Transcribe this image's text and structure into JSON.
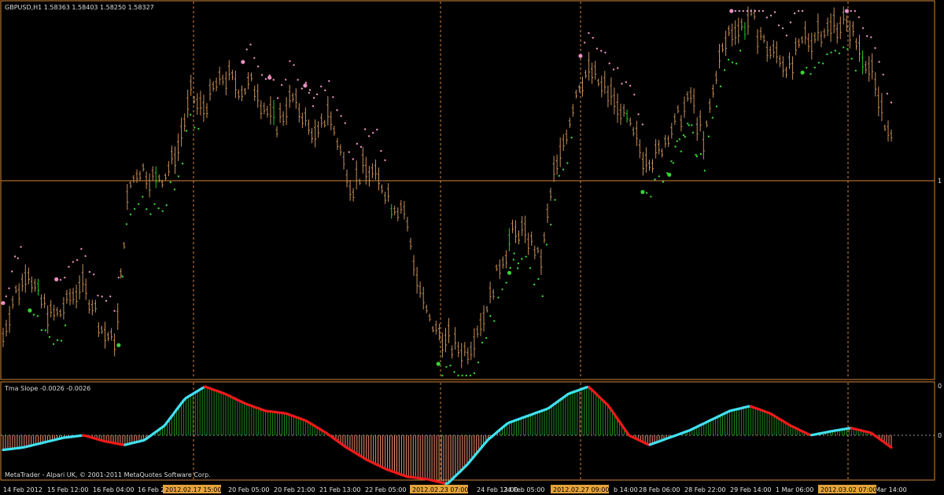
{
  "colors": {
    "background": "#000000",
    "frame": "#d2863a",
    "bar": "#c6905a",
    "bar_bull_accent": "#22cc22",
    "upper_band_dots": "#e890c0",
    "lower_band_dots": "#36d236",
    "separator_line": "#d2863a",
    "price_line": "#d2863a",
    "slope_positive_hist": "#1f8c1f",
    "slope_negative_hist": "#f09070",
    "slope_rising_line": "#40e0f0",
    "slope_falling_line": "#ee1a1a",
    "zero_line": "#c8c8c8",
    "date_highlight": "#e5a33a"
  },
  "main_panel": {
    "title": "GBPUSD,H1  1.58363 1.58403 1.58250 1.58327",
    "icon": "chart-window-icon"
  },
  "indicator_panel": {
    "title": "Tma Slope -0.0026 -0.0026",
    "axis_labels": [
      "0",
      "0"
    ]
  },
  "copyright": "MetaTrader - Alpari UK, © 2001-2011 MetaQuotes Software Corp.",
  "time_axis": {
    "labels": [
      "14 Feb 2012",
      "15 Feb 12:00",
      "16 Feb 04:00",
      "16 Feb 2",
      "20 Feb 05:00",
      "20 Feb 21:00",
      "21 Feb 13:00",
      "22 Feb 05:00",
      "24 Feb 13:00",
      "24 Feb 05:00",
      "b 14:00",
      "28 Feb 06:00",
      "28 Feb 22:00",
      "29 Feb 14:00",
      "1 Mar 06:00",
      "Mar 14:00"
    ],
    "highlighted": [
      "2012.02.17 15:00",
      "2012.02.23 07:00",
      "2012.02.27 09:00",
      "2012.03.02 07:00"
    ]
  },
  "price_axis": {
    "label": "1"
  },
  "chart_data": {
    "type": "candlestick",
    "symbol": "GBPUSD",
    "timeframe": "H1",
    "last_quote": {
      "open": 1.58363,
      "high": 1.58403,
      "low": 1.5825,
      "close": 1.58327
    },
    "period_separators": [
      "2012.02.17 15:00",
      "2012.02.23 07:00",
      "2012.02.27 09:00",
      "2012.03.02 07:00"
    ],
    "price_series_relative": [
      0.1,
      0.22,
      0.28,
      0.2,
      0.15,
      0.18,
      0.24,
      0.2,
      0.1,
      0.08,
      0.52,
      0.58,
      0.54,
      0.56,
      0.63,
      0.78,
      0.74,
      0.82,
      0.84,
      0.8,
      0.82,
      0.74,
      0.7,
      0.78,
      0.72,
      0.66,
      0.74,
      0.62,
      0.52,
      0.58,
      0.55,
      0.48,
      0.46,
      0.28,
      0.14,
      0.1,
      0.06,
      0.05,
      0.12,
      0.22,
      0.33,
      0.4,
      0.38,
      0.3,
      0.55,
      0.68,
      0.82,
      0.86,
      0.8,
      0.76,
      0.7,
      0.62,
      0.6,
      0.66,
      0.72,
      0.78,
      0.64,
      0.85,
      0.96,
      0.98,
      1.0,
      0.92,
      0.9,
      0.86,
      0.94,
      0.96,
      0.98,
      1.0,
      0.95,
      0.88,
      0.78,
      0.64
    ],
    "tma_slope": [
      -0.3,
      -0.25,
      -0.15,
      -0.05,
      0.0,
      -0.12,
      -0.2,
      -0.1,
      0.2,
      0.75,
      1.0,
      0.85,
      0.65,
      0.5,
      0.45,
      0.3,
      0.05,
      -0.25,
      -0.5,
      -0.7,
      -0.85,
      -0.9,
      -1.0,
      -0.6,
      -0.1,
      0.25,
      0.4,
      0.55,
      0.85,
      1.0,
      0.6,
      0.0,
      -0.2,
      -0.05,
      0.1,
      0.3,
      0.5,
      0.6,
      0.45,
      0.2,
      0.0,
      0.08,
      0.15,
      0.05,
      -0.25
    ],
    "title": "GBPUSD,H1",
    "indicator": "Tma Slope"
  }
}
